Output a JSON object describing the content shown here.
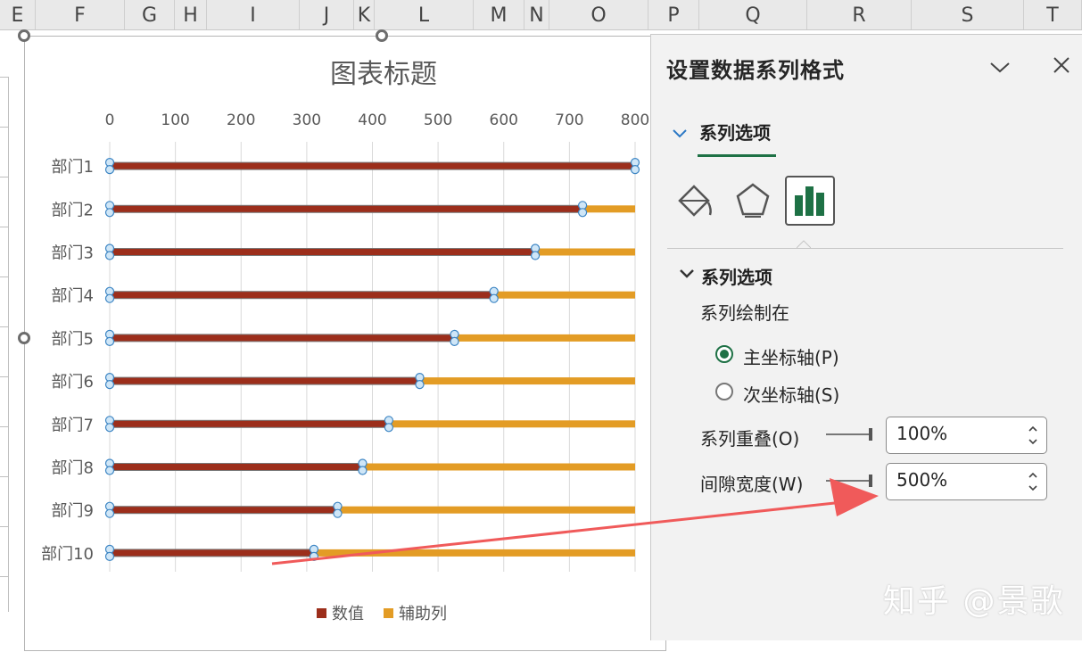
{
  "columns": [
    "E",
    "F",
    "G",
    "H",
    "I",
    "J",
    "K",
    "L",
    "M",
    "N",
    "O",
    "P",
    "Q",
    "R",
    "S",
    "T"
  ],
  "chart_data": {
    "type": "bar",
    "orientation": "horizontal",
    "title": "图表标题",
    "categories": [
      "部门1",
      "部门2",
      "部门3",
      "部门4",
      "部门5",
      "部门6",
      "部门7",
      "部门8",
      "部门9",
      "部门10"
    ],
    "series": [
      {
        "name": "数值",
        "values": [
          800,
          720,
          648,
          585,
          525,
          472,
          425,
          385,
          347,
          311
        ],
        "color": "#9c2e1b"
      },
      {
        "name": "辅助列",
        "values": [
          800,
          800,
          800,
          800,
          800,
          800,
          800,
          800,
          800,
          800
        ],
        "color": "#e39c25"
      }
    ],
    "xlim": [
      0,
      800
    ],
    "xticks": [
      0,
      100,
      200,
      300,
      400,
      500,
      600,
      700,
      800
    ],
    "axis_position": "top",
    "grid": true,
    "legend": "bottom",
    "series_selected": "数值"
  },
  "pane": {
    "title": "设置数据系列格式",
    "tab_label": "系列选项",
    "section_label": "系列选项",
    "plot_on_label": "系列绘制在",
    "primary_axis": "主坐标轴(P)",
    "secondary_axis": "次坐标轴(S)",
    "overlap_label": "系列重叠(O)",
    "overlap_value": "100%",
    "gap_label": "间隙宽度(W)",
    "gap_value": "500%",
    "selected_axis": "primary",
    "accent": "#1e7145"
  },
  "watermark": "知乎 @景歌"
}
